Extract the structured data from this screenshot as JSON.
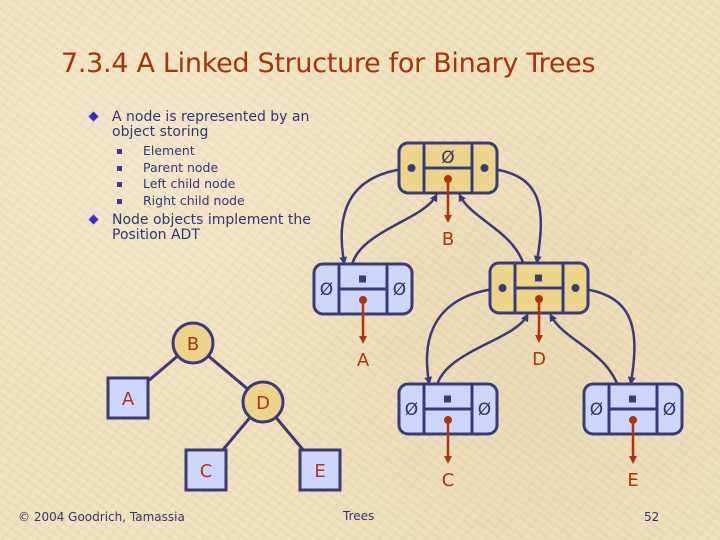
{
  "slide": {
    "title": "7.3.4 A Linked Structure for Binary Trees",
    "bullets": [
      {
        "text": "A node is represented by an object storing",
        "subitems": [
          "Element",
          "Parent node",
          "Left child node",
          "Right child node"
        ]
      },
      {
        "text": "Node objects implement the Position ADT",
        "subitems": []
      }
    ],
    "footer": {
      "copyright": "© 2004 Goodrich, Tamassia",
      "center": "Trees",
      "page_number": "52"
    }
  },
  "colors": {
    "title": "#a8320c",
    "text": "#33337a",
    "internal_fill": "#ecd58a",
    "external_fill": "#cdd6fb",
    "stroke": "#3a3a7a",
    "element_arrow": "#b2320e"
  },
  "abstract_tree": {
    "nodes": [
      {
        "id": "B",
        "label": "B",
        "kind": "internal"
      },
      {
        "id": "A",
        "label": "A",
        "kind": "external"
      },
      {
        "id": "D",
        "label": "D",
        "kind": "internal"
      },
      {
        "id": "C",
        "label": "C",
        "kind": "external"
      },
      {
        "id": "E",
        "label": "E",
        "kind": "external"
      }
    ],
    "edges": [
      [
        "B",
        "A"
      ],
      [
        "B",
        "D"
      ],
      [
        "D",
        "C"
      ],
      [
        "D",
        "E"
      ]
    ]
  },
  "linked_structure": {
    "null_symbol": "Ø",
    "nodes": [
      {
        "id": "B",
        "element": "B",
        "kind": "internal",
        "parent": null,
        "left": "A",
        "right": "D"
      },
      {
        "id": "A",
        "element": "A",
        "kind": "external",
        "parent": "B",
        "left": null,
        "right": null
      },
      {
        "id": "D",
        "element": "D",
        "kind": "internal",
        "parent": "B",
        "left": "C",
        "right": "E"
      },
      {
        "id": "C",
        "element": "C",
        "kind": "external",
        "parent": "D",
        "left": null,
        "right": null
      },
      {
        "id": "E",
        "element": "E",
        "kind": "external",
        "parent": "D",
        "left": null,
        "right": null
      }
    ]
  }
}
